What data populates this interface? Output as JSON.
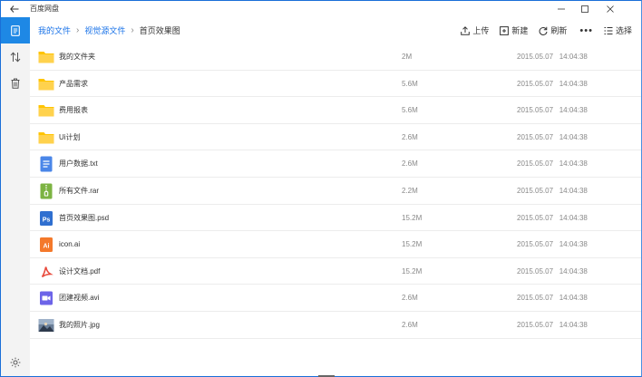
{
  "titlebar": {
    "app_title": "百度网盘"
  },
  "breadcrumb": {
    "items": [
      "我的文件",
      "视觉源文件"
    ],
    "current": "首页效果图"
  },
  "toolbar": {
    "upload_label": "上传",
    "new_label": "新建",
    "refresh_label": "刷新",
    "more_label": "•••",
    "select_label": "选择"
  },
  "files": [
    {
      "name": "我的文件夹",
      "size": "2M",
      "date": "2015.05.07   14:04:38",
      "type": "folder"
    },
    {
      "name": "产品需求",
      "size": "5.6M",
      "date": "2015.05.07   14:04:38",
      "type": "folder"
    },
    {
      "name": "费用报表",
      "size": "5.6M",
      "date": "2015.05.07   14:04:38",
      "type": "folder"
    },
    {
      "name": "Ui计划",
      "size": "2.6M",
      "date": "2015.05.07   14:04:38",
      "type": "folder"
    },
    {
      "name": "用户数据.txt",
      "size": "2.6M",
      "date": "2015.05.07   14:04:38",
      "type": "txt"
    },
    {
      "name": "所有文件.rar",
      "size": "2.2M",
      "date": "2015.05.07   14:04:38",
      "type": "rar"
    },
    {
      "name": "首页效果图.psd",
      "size": "15.2M",
      "date": "2015.05.07   14:04:38",
      "type": "psd",
      "icon_text": "Ps"
    },
    {
      "name": "icon.ai",
      "size": "15.2M",
      "date": "2015.05.07   14:04:38",
      "type": "ai",
      "icon_text": "Ai"
    },
    {
      "name": "设计文档.pdf",
      "size": "15.2M",
      "date": "2015.05.07   14:04:38",
      "type": "pdf"
    },
    {
      "name": "团建视频.avi",
      "size": "2.6M",
      "date": "2015.05.07   14:04:38",
      "type": "avi"
    },
    {
      "name": "我的照片.jpg",
      "size": "2.6M",
      "date": "2015.05.07   14:04:38",
      "type": "jpg"
    }
  ],
  "colors": {
    "accent": "#1e88e5",
    "folder": "#ffc400",
    "txt": "#4a86e8",
    "rar": "#7cb342",
    "psd": "#2f6fd0",
    "ai": "#f4792b",
    "pdf": "#e84a3c",
    "avi": "#6c63e8"
  }
}
